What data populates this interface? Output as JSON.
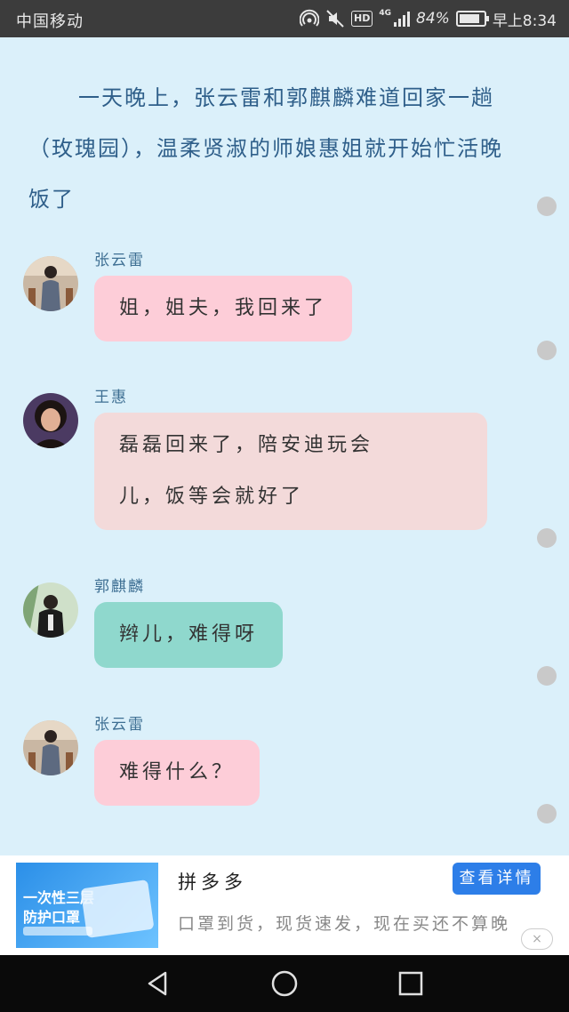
{
  "status_bar": {
    "carrier": "中国移动",
    "hd": "HD",
    "network": "4G",
    "battery_percent_text": "84%",
    "battery_level": 0.84,
    "time": "早上8:34"
  },
  "intro_text": "一天晚上，张云雷和郭麒麟难道回家一趟（玫瑰园），温柔贤淑的师娘惠姐就开始忙活晚饭了",
  "messages": [
    {
      "name": "张云雷",
      "text": "姐，姐夫，我回来了"
    },
    {
      "name": "王惠",
      "line1": "磊磊回来了，陪安迪玩会",
      "line2": "儿，饭等会就好了"
    },
    {
      "name": "郭麒麟",
      "text": "辫儿，难得呀"
    },
    {
      "name": "张云雷",
      "text": "难得什么？"
    }
  ],
  "ad": {
    "image_line1": "一次性三层",
    "image_line2": "防护口罩",
    "brand": "拼多多",
    "description": "口罩到货，现货速发，现在买还不算晚",
    "button_label": "查看详情",
    "close_label": "×"
  },
  "icons": {
    "hotspot": "hotspot-icon",
    "mute": "mute-icon",
    "signal": "signal-icon",
    "battery": "battery-icon",
    "back": "back-icon",
    "home": "home-icon",
    "recent": "recent-apps-icon"
  },
  "colors": {
    "background": "#dbf0fa",
    "bubble_pink": "#fdcdd8",
    "bubble_rose": "#f3dada",
    "bubble_teal": "#8fd8cd",
    "button_blue": "#2d7ee8"
  }
}
